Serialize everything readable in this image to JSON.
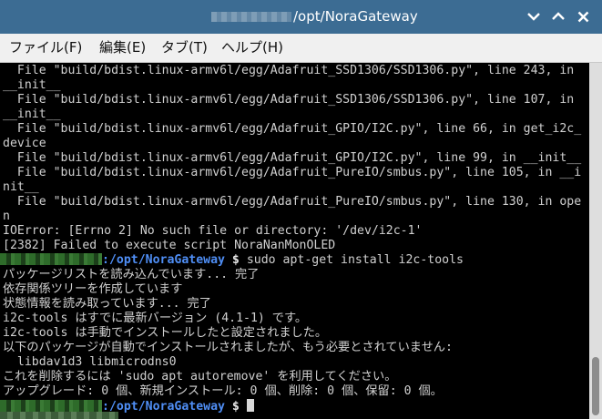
{
  "window": {
    "title": "/opt/NoraGateway",
    "controls": {
      "minimize_icon": "chevron-down-icon",
      "maximize_icon": "chevron-up-icon",
      "close_icon": "close-icon"
    }
  },
  "menu": [
    "ファイル(F)",
    "編集(E)",
    "タブ(T)",
    "ヘルプ(H)"
  ],
  "terminal": {
    "lines": [
      "  File \"build/bdist.linux-armv6l/egg/Adafruit_SSD1306/SSD1306.py\", line 243, in",
      "__init__",
      "  File \"build/bdist.linux-armv6l/egg/Adafruit_SSD1306/SSD1306.py\", line 107, in",
      "__init__",
      "  File \"build/bdist.linux-armv6l/egg/Adafruit_GPIO/I2C.py\", line 66, in get_i2c_",
      "device",
      "  File \"build/bdist.linux-armv6l/egg/Adafruit_GPIO/I2C.py\", line 99, in __init__",
      "  File \"build/bdist.linux-armv6l/egg/Adafruit_PureIO/smbus.py\", line 105, in __i",
      "nit__",
      "  File \"build/bdist.linux-armv6l/egg/Adafruit_PureIO/smbus.py\", line 130, in ope",
      "n",
      "IOError: [Errno 2] No such file or directory: '/dev/i2c-1'",
      "[2382] Failed to execute script NoraNanMonOLED"
    ],
    "prompt1": {
      "path": ":/opt/NoraGateway",
      "symbol": " $",
      "command": " sudo apt-get install i2c-tools"
    },
    "output": [
      "パッケージリストを読み込んでいます... 完了",
      "依存関係ツリーを作成しています",
      "状態情報を読み取っています... 完了",
      "i2c-tools はすでに最新バージョン (4.1-1) です。",
      "i2c-tools は手動でインストールしたと設定されました。",
      "以下のパッケージが自動でインストールされましたが、もう必要とされていません:",
      "  libdav1d3 libmicrodns0",
      "これを削除するには 'sudo apt autoremove' を利用してください。",
      "アップグレード: 0 個、新規インストール: 0 個、削除: 0 個、保留: 0 個。"
    ],
    "prompt2": {
      "path": ":/opt/NoraGateway",
      "symbol": " $",
      "command": " "
    }
  },
  "colors": {
    "titlebar": "#3c6c93",
    "terminal_bg": "#000000",
    "terminal_fg": "#d0d0d0",
    "prompt_path": "#4f8ef5"
  }
}
